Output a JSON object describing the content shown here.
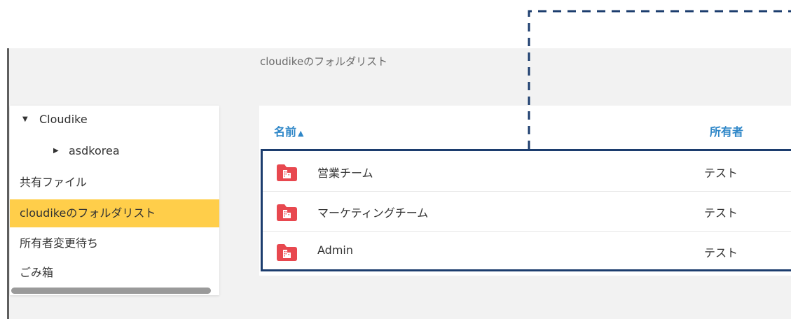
{
  "breadcrumb": "cloudikeのフォルダリスト",
  "sidebar": {
    "items": [
      {
        "label": "Cloudike",
        "caret": "▼"
      },
      {
        "label": "asdkorea",
        "caret": "▶"
      },
      {
        "label": "共有ファイル"
      },
      {
        "label": "cloudikeのフォルダリスト",
        "active": true
      },
      {
        "label": "所有者変更待ち"
      },
      {
        "label": "ごみ箱"
      }
    ]
  },
  "table": {
    "headers": {
      "name": "名前",
      "sort_icon": "▲",
      "owner": "所有者"
    },
    "rows": [
      {
        "name": "営業チーム",
        "owner": "テスト",
        "icon": "team-folder-icon"
      },
      {
        "name": "マーケティングチーム",
        "owner": "テスト",
        "icon": "team-folder-icon"
      },
      {
        "name": "Admin",
        "owner": "テスト",
        "icon": "team-folder-icon"
      }
    ]
  },
  "colors": {
    "accent": "#2f87c8",
    "active_item": "#ffce4a",
    "folder": "#e8484f",
    "highlight_border": "#1c3d6e"
  }
}
